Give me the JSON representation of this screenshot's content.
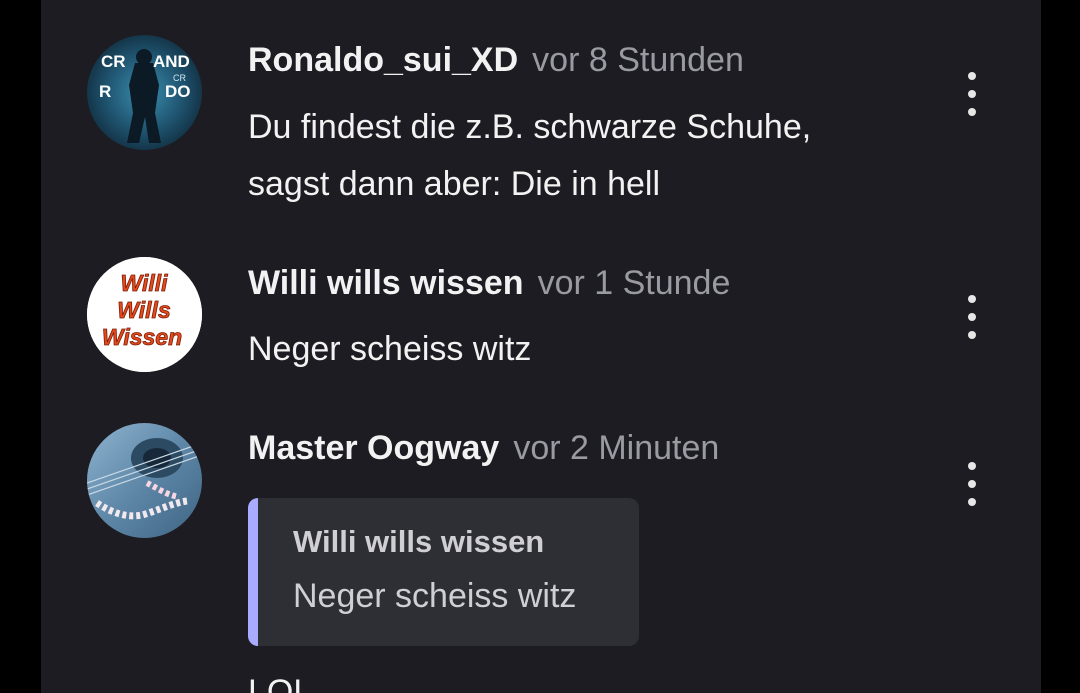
{
  "comments": [
    {
      "username": "Ronaldo_sui_XD",
      "timestamp": "vor 8 Stunden",
      "lines": [
        "Du findest die z.B. schwarze Schuhe,",
        "sagst dann aber: Die in hell"
      ],
      "avatar": {
        "icon": "soccer-player-avatar",
        "text_left": "CR",
        "text_right": "AND",
        "text_left_2": "R",
        "text_right_2": "DO",
        "badge": "CR"
      },
      "menu_icon": "more-vertical-icon"
    },
    {
      "username": "Willi wills wissen",
      "timestamp": "vor 1 Stunde",
      "lines": [
        "Neger scheiss witz"
      ],
      "avatar": {
        "icon": "text-logo-avatar",
        "line1": "Willi",
        "line2": "Wills",
        "line3": "Wissen"
      },
      "menu_icon": "more-vertical-icon"
    },
    {
      "username": "Master Oogway",
      "timestamp": "vor 2 Minuten",
      "quote": {
        "author": "Willi wills wissen",
        "text": "Neger scheiss witz"
      },
      "reply": "LOL",
      "avatar": {
        "icon": "guitar-photo-avatar"
      },
      "menu_icon": "more-vertical-icon"
    }
  ],
  "colors": {
    "background": "#1c1c22",
    "outer": "#000000",
    "text": "#f2f2f2",
    "muted": "#9a9aa2",
    "quote_bg": "#2e2e35",
    "quote_accent": "#a9abff"
  }
}
